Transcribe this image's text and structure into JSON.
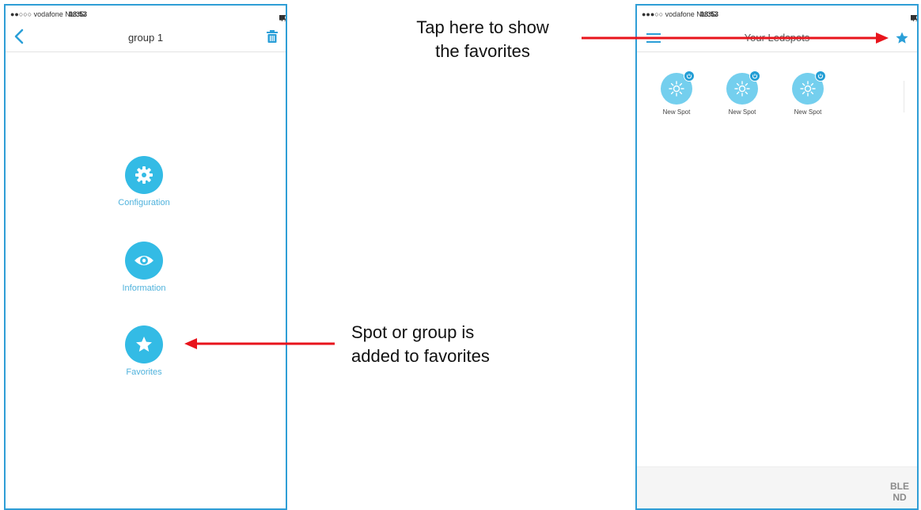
{
  "left_screen": {
    "status": {
      "carrier": "●●○○○ vodafone NL  3G",
      "time": "08:53",
      "battery": "47%"
    },
    "nav": {
      "title": "group 1"
    },
    "menu": [
      {
        "label": "Configuration",
        "icon": "gear-icon"
      },
      {
        "label": "Information",
        "icon": "eye-icon"
      },
      {
        "label": "Favorites",
        "icon": "star-icon"
      }
    ]
  },
  "right_screen": {
    "status": {
      "carrier": "●●●○○ vodafone NL  3G",
      "time": "08:53",
      "battery": "47%"
    },
    "nav": {
      "title": "Your Ledspots"
    },
    "spots": [
      {
        "label": "New Spot"
      },
      {
        "label": "New Spot"
      },
      {
        "label": "New Spot"
      }
    ],
    "logo": {
      "line1": "BLE",
      "line2": "ND"
    }
  },
  "annotations": {
    "top_line1": "Tap here to show",
    "top_line2": "the favorites",
    "bottom_line1": "Spot or group is",
    "bottom_line2": "added to favorites"
  },
  "colors": {
    "accent": "#33bbe5",
    "frame": "#2f9ed6",
    "arrow": "#e8141c"
  }
}
